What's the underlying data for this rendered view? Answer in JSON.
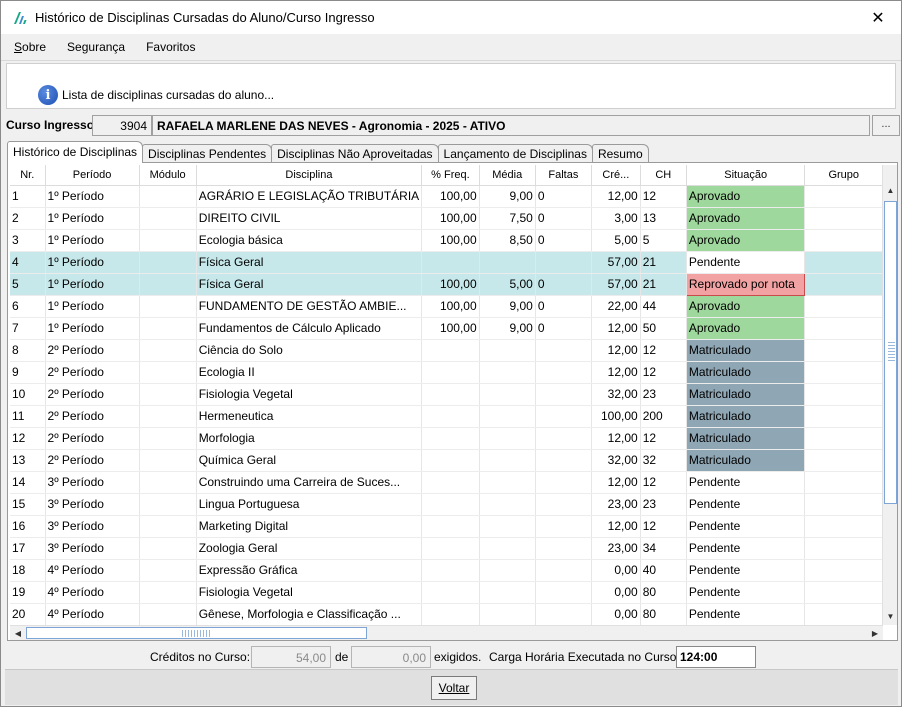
{
  "window": {
    "title": "Histórico de Disciplinas Cursadas do Aluno/Curso Ingresso",
    "close_symbol": "✕"
  },
  "menu": [
    {
      "label": "Sobre"
    },
    {
      "label": "Segurança"
    },
    {
      "label": "Favoritos"
    }
  ],
  "info": {
    "icon": "info-icon",
    "text": "Lista de disciplinas cursadas do aluno..."
  },
  "curso": {
    "label": "Curso Ingresso:",
    "code": "3904",
    "name": "RAFAELA MARLENE DAS NEVES - Agronomia - 2025 - ATIVO",
    "browse_label": "..."
  },
  "tabs": [
    {
      "label": "Histórico de Disciplinas",
      "active": true
    },
    {
      "label": "Disciplinas Pendentes",
      "active": false
    },
    {
      "label": "Disciplinas Não Aproveitadas",
      "active": false
    },
    {
      "label": "Lançamento de Disciplinas",
      "active": false
    },
    {
      "label": "Resumo",
      "active": false
    }
  ],
  "table": {
    "columns": [
      "Nr.",
      "Período",
      "Módulo",
      "Disciplina",
      "% Freq.",
      "Média",
      "Faltas",
      "Cré...",
      "CH",
      "Situação",
      "Grupo"
    ],
    "rows": [
      {
        "nr": "1",
        "periodo": "1º Período",
        "modulo": "",
        "disciplina": "AGRÁRIO E LEGISLAÇÃO TRIBUTÁRIA",
        "freq": "100,00",
        "media": "9,00",
        "faltas": "0",
        "creditos": "12,00",
        "ch": "12",
        "situacao": "Aprovado",
        "status": "ok",
        "grupo": "",
        "selected": false
      },
      {
        "nr": "2",
        "periodo": "1º Período",
        "modulo": "",
        "disciplina": "DIREITO CIVIL",
        "freq": "100,00",
        "media": "7,50",
        "faltas": "0",
        "creditos": "3,00",
        "ch": "13",
        "situacao": "Aprovado",
        "status": "ok",
        "grupo": "",
        "selected": false
      },
      {
        "nr": "3",
        "periodo": "1º Período",
        "modulo": "",
        "disciplina": "Ecologia básica",
        "freq": "100,00",
        "media": "8,50",
        "faltas": "0",
        "creditos": "5,00",
        "ch": "5",
        "situacao": "Aprovado",
        "status": "ok",
        "grupo": "",
        "selected": false
      },
      {
        "nr": "4",
        "periodo": "1º Período",
        "modulo": "",
        "disciplina": "Física Geral",
        "freq": "",
        "media": "",
        "faltas": "",
        "creditos": "57,00",
        "ch": "21",
        "situacao": "Pendente",
        "status": "pend",
        "grupo": "",
        "selected": true
      },
      {
        "nr": "5",
        "periodo": "1º Período",
        "modulo": "",
        "disciplina": "Física Geral",
        "freq": "100,00",
        "media": "5,00",
        "faltas": "0",
        "creditos": "57,00",
        "ch": "21",
        "situacao": "Reprovado por nota",
        "status": "rep",
        "grupo": "",
        "selected": true
      },
      {
        "nr": "6",
        "periodo": "1º Período",
        "modulo": "",
        "disciplina": "FUNDAMENTO DE GESTÃO AMBIE...",
        "freq": "100,00",
        "media": "9,00",
        "faltas": "0",
        "creditos": "22,00",
        "ch": "44",
        "situacao": "Aprovado",
        "status": "ok",
        "grupo": "",
        "selected": false
      },
      {
        "nr": "7",
        "periodo": "1º Período",
        "modulo": "",
        "disciplina": "Fundamentos de Cálculo Aplicado",
        "freq": "100,00",
        "media": "9,00",
        "faltas": "0",
        "creditos": "12,00",
        "ch": "50",
        "situacao": "Aprovado",
        "status": "ok",
        "grupo": "",
        "selected": false
      },
      {
        "nr": "8",
        "periodo": "2º Período",
        "modulo": "",
        "disciplina": "Ciência do Solo",
        "freq": "",
        "media": "",
        "faltas": "",
        "creditos": "12,00",
        "ch": "12",
        "situacao": "Matriculado",
        "status": "mat",
        "grupo": "",
        "selected": false
      },
      {
        "nr": "9",
        "periodo": "2º Período",
        "modulo": "",
        "disciplina": "Ecologia II",
        "freq": "",
        "media": "",
        "faltas": "",
        "creditos": "12,00",
        "ch": "12",
        "situacao": "Matriculado",
        "status": "mat",
        "grupo": "",
        "selected": false
      },
      {
        "nr": "10",
        "periodo": "2º Período",
        "modulo": "",
        "disciplina": "Fisiologia Vegetal",
        "freq": "",
        "media": "",
        "faltas": "",
        "creditos": "32,00",
        "ch": "23",
        "situacao": "Matriculado",
        "status": "mat",
        "grupo": "",
        "selected": false
      },
      {
        "nr": "11",
        "periodo": "2º Período",
        "modulo": "",
        "disciplina": "Hermeneutica",
        "freq": "",
        "media": "",
        "faltas": "",
        "creditos": "100,00",
        "ch": "200",
        "situacao": "Matriculado",
        "status": "mat",
        "grupo": "",
        "selected": false
      },
      {
        "nr": "12",
        "periodo": "2º Período",
        "modulo": "",
        "disciplina": "Morfologia",
        "freq": "",
        "media": "",
        "faltas": "",
        "creditos": "12,00",
        "ch": "12",
        "situacao": "Matriculado",
        "status": "mat",
        "grupo": "",
        "selected": false
      },
      {
        "nr": "13",
        "periodo": "2º Período",
        "modulo": "",
        "disciplina": "Química Geral",
        "freq": "",
        "media": "",
        "faltas": "",
        "creditos": "32,00",
        "ch": "32",
        "situacao": "Matriculado",
        "status": "mat",
        "grupo": "",
        "selected": false
      },
      {
        "nr": "14",
        "periodo": "3º Período",
        "modulo": "",
        "disciplina": "Construindo uma Carreira de Suces...",
        "freq": "",
        "media": "",
        "faltas": "",
        "creditos": "12,00",
        "ch": "12",
        "situacao": "Pendente",
        "status": "pend",
        "grupo": "",
        "selected": false
      },
      {
        "nr": "15",
        "periodo": "3º Período",
        "modulo": "",
        "disciplina": "Lingua Portuguesa",
        "freq": "",
        "media": "",
        "faltas": "",
        "creditos": "23,00",
        "ch": "23",
        "situacao": "Pendente",
        "status": "pend",
        "grupo": "",
        "selected": false
      },
      {
        "nr": "16",
        "periodo": "3º Período",
        "modulo": "",
        "disciplina": "Marketing Digital",
        "freq": "",
        "media": "",
        "faltas": "",
        "creditos": "12,00",
        "ch": "12",
        "situacao": "Pendente",
        "status": "pend",
        "grupo": "",
        "selected": false
      },
      {
        "nr": "17",
        "periodo": "3º Período",
        "modulo": "",
        "disciplina": "Zoologia Geral",
        "freq": "",
        "media": "",
        "faltas": "",
        "creditos": "23,00",
        "ch": "34",
        "situacao": "Pendente",
        "status": "pend",
        "grupo": "",
        "selected": false
      },
      {
        "nr": "18",
        "periodo": "4º Período",
        "modulo": "",
        "disciplina": "Expressão Gráfica",
        "freq": "",
        "media": "",
        "faltas": "",
        "creditos": "0,00",
        "ch": "40",
        "situacao": "Pendente",
        "status": "pend",
        "grupo": "",
        "selected": false
      },
      {
        "nr": "19",
        "periodo": "4º Período",
        "modulo": "",
        "disciplina": "Fisiologia Vegetal",
        "freq": "",
        "media": "",
        "faltas": "",
        "creditos": "0,00",
        "ch": "80",
        "situacao": "Pendente",
        "status": "pend",
        "grupo": "",
        "selected": false
      },
      {
        "nr": "20",
        "periodo": "4º Período",
        "modulo": "",
        "disciplina": "Gênese, Morfologia e Classificação ...",
        "freq": "",
        "media": "",
        "faltas": "",
        "creditos": "0,00",
        "ch": "80",
        "situacao": "Pendente",
        "status": "pend",
        "grupo": "",
        "selected": false
      }
    ]
  },
  "footer": {
    "creditos_label": "Créditos no Curso:",
    "creditos_value": "54,00",
    "de_label": "de",
    "exigidos_value": "0,00",
    "exigidos_label": "exigidos.",
    "carga_label": "Carga Horária Executada no Curso:",
    "carga_value": "124:00"
  },
  "buttons": {
    "voltar": "Voltar"
  },
  "colors": {
    "aprovado": "#9fd89c",
    "matriculado": "#8fa6b4",
    "reprovado": "#f2a2a2",
    "selected_row": "#c6e8ea"
  }
}
